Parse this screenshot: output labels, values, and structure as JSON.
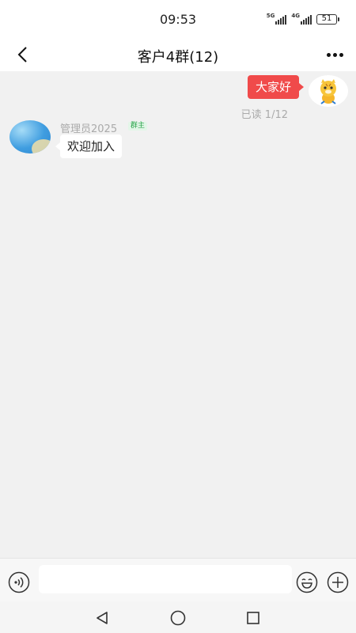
{
  "status_bar": {
    "time": "09:53",
    "network_1": "5G",
    "network_2": "4G",
    "battery": "51"
  },
  "header": {
    "title": "客户4群(12)",
    "back_icon": "chevron-left-icon",
    "more_icon": "more-dots-icon"
  },
  "messages": [
    {
      "direction": "outgoing",
      "text": "大家好",
      "read_status": "已读 1/12",
      "bubble_color": "#f04a4a"
    },
    {
      "direction": "incoming",
      "sender": "管理员2025",
      "badge": "群主",
      "text": "欢迎加入"
    }
  ],
  "input_bar": {
    "value": "",
    "voice_icon": "voice-icon",
    "emoji_icon": "emoji-icon",
    "plus_icon": "plus-icon"
  },
  "nav_bar": {
    "back_icon": "triangle-back-icon",
    "home_icon": "circle-home-icon",
    "recents_icon": "square-recents-icon"
  },
  "colors": {
    "accent": "#f04a4a",
    "background": "#f1f1f1",
    "badge_green": "#2aa44a"
  }
}
